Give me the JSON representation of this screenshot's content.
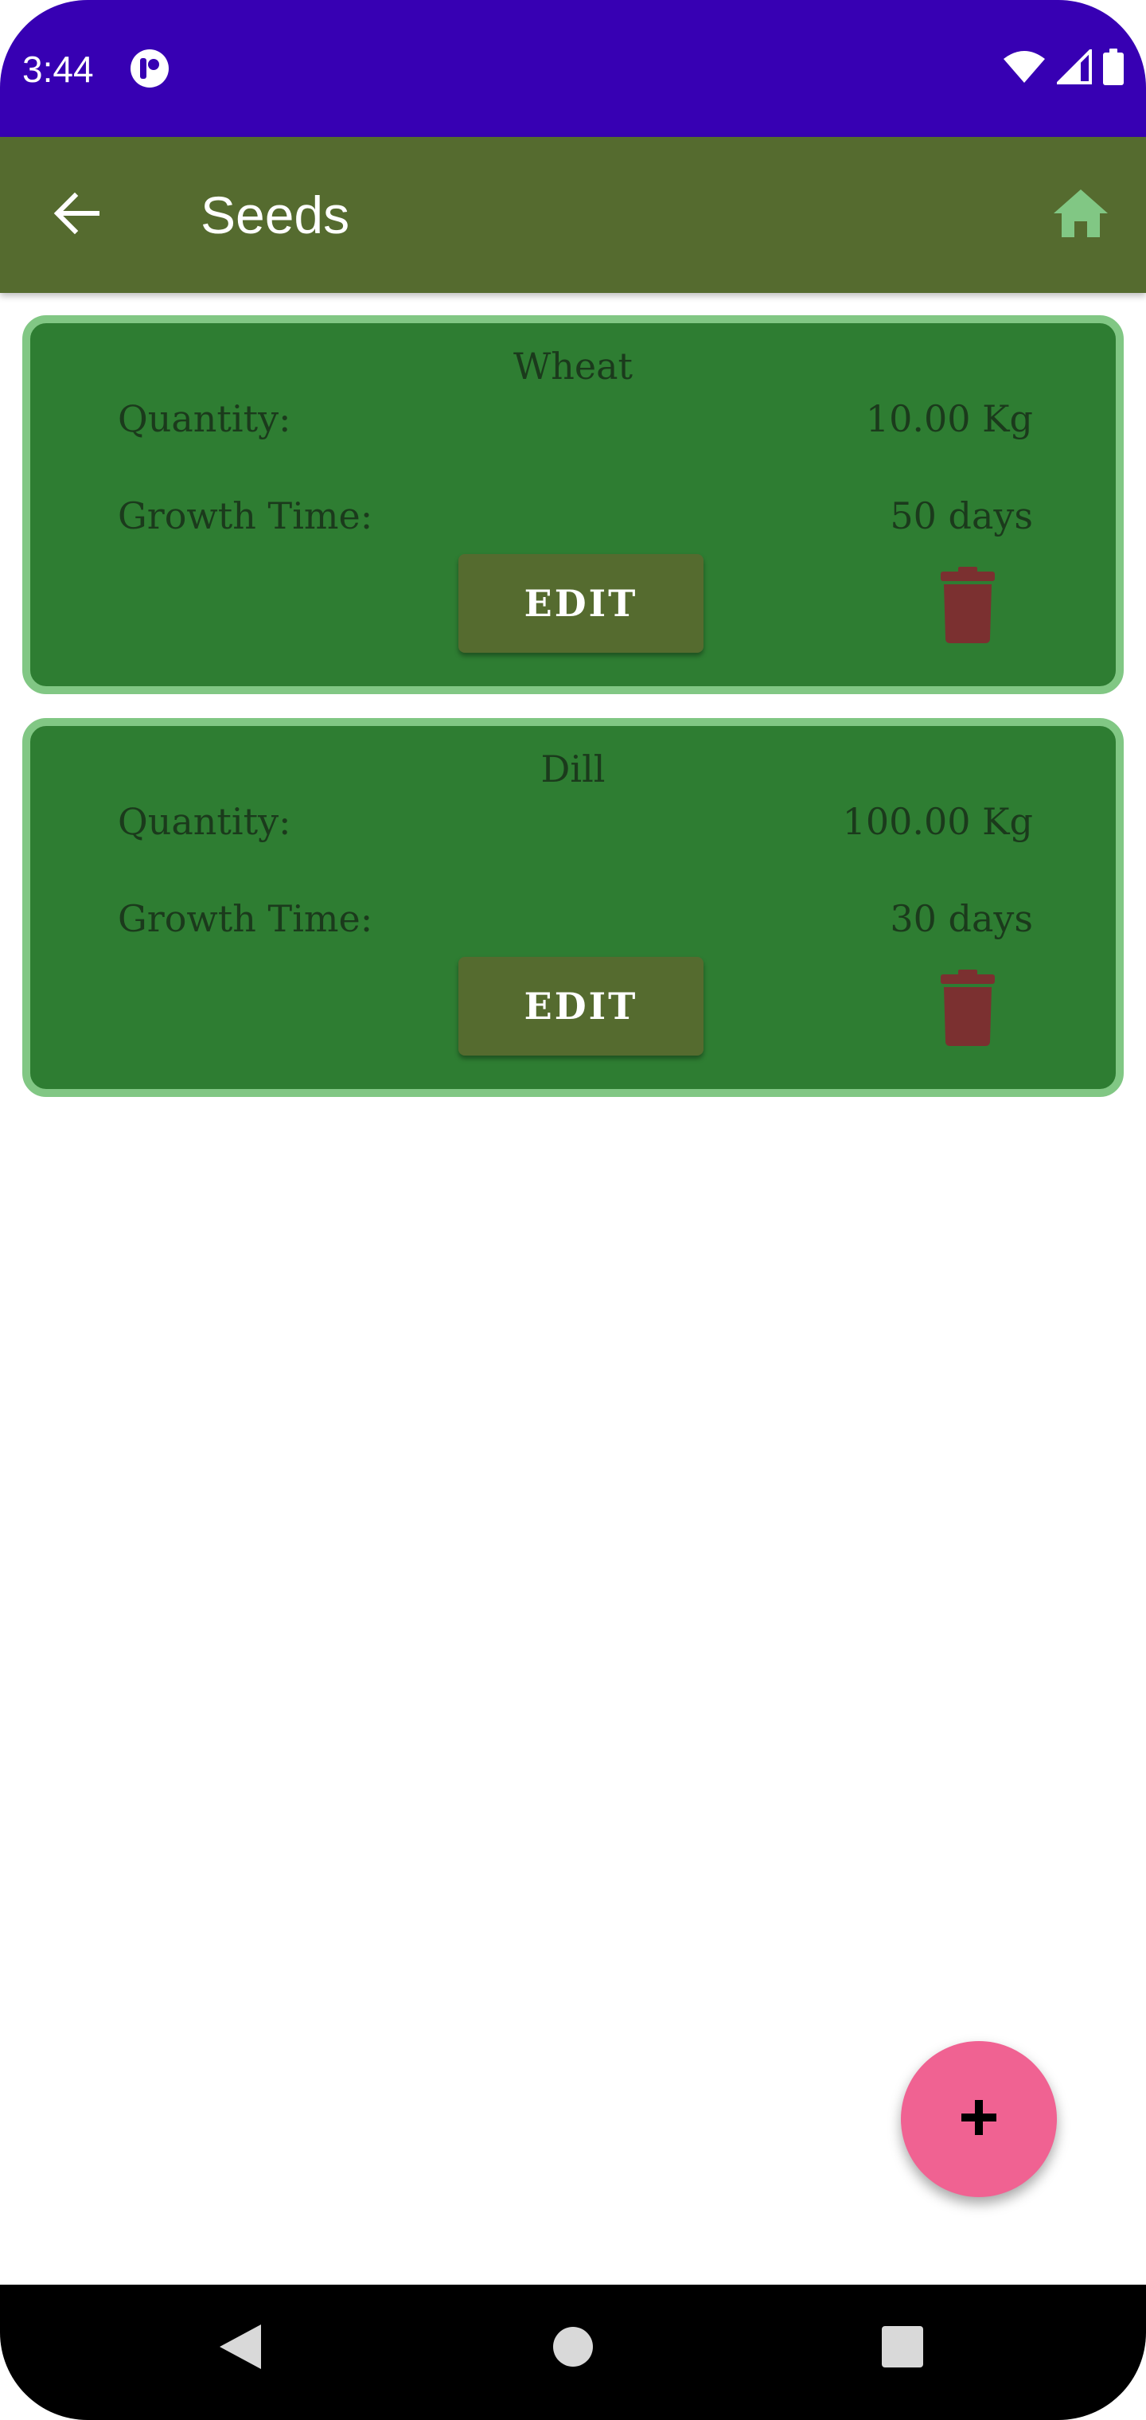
{
  "status_bar": {
    "time": "3:44",
    "background": "#3700b3"
  },
  "app_bar": {
    "title": "Seeds",
    "background": "#556b2f",
    "home_icon_color": "#81c784"
  },
  "seeds": [
    {
      "name": "Wheat",
      "quantity_label": "Quantity:",
      "quantity_value": "10.00 Kg",
      "growth_label": "Growth Time:",
      "growth_value": "50 days",
      "edit_label": "EDIT"
    },
    {
      "name": "Dill",
      "quantity_label": "Quantity:",
      "quantity_value": "100.00 Kg",
      "growth_label": "Growth Time:",
      "growth_value": "30 days",
      "edit_label": "EDIT"
    }
  ],
  "colors": {
    "card_background": "#2e7d32",
    "card_border": "#81c784",
    "edit_button": "#556b2f",
    "delete_icon": "#7b3030",
    "fab": "#f06292"
  },
  "fab": {
    "label": "+"
  },
  "icons": {
    "back": "arrow-left-icon",
    "home": "home-icon",
    "delete": "trash-icon",
    "add": "plus-icon"
  }
}
